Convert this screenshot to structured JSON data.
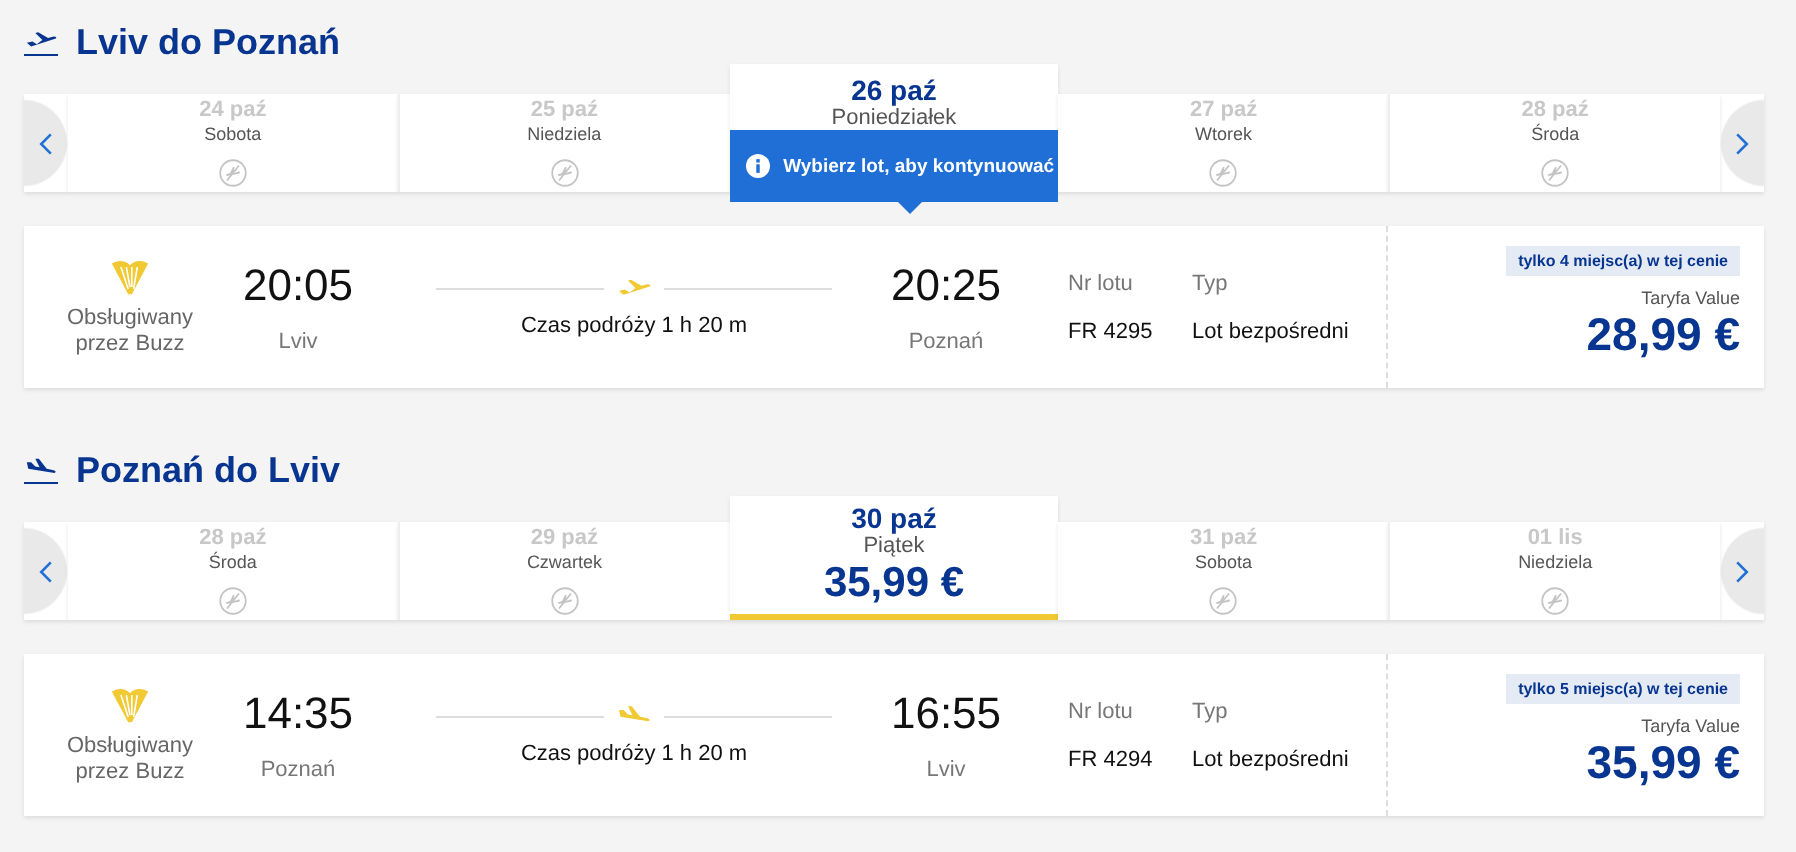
{
  "sections": [
    {
      "kind": "outbound",
      "title": "Lviv do Poznań",
      "dates": [
        {
          "date": "24 paź",
          "day": "Sobota",
          "selected": false
        },
        {
          "date": "25 paź",
          "day": "Niedziela",
          "selected": false
        },
        {
          "date": "26 paź",
          "day": "Poniedziałek",
          "selected": true
        },
        {
          "date": "27 paź",
          "day": "Wtorek",
          "selected": false
        },
        {
          "date": "28 paź",
          "day": "Środa",
          "selected": false
        }
      ],
      "tooltip": "Wybierz lot, aby kontynuować",
      "flight": {
        "operator": "Obsługiwany przez Buzz",
        "dep_time": "20:05",
        "dep_city": "Lviv",
        "duration": "Czas podróży 1 h 20 m",
        "arr_time": "20:25",
        "arr_city": "Poznań",
        "flight_no_label": "Nr lotu",
        "flight_no": "FR 4295",
        "type_label": "Typ",
        "type": "Lot bezpośredni",
        "seats": "tylko 4 miejsc(a) w tej cenie",
        "fare": "Taryfa Value",
        "price": "28,99 €"
      }
    },
    {
      "kind": "return",
      "title": "Poznań do Lviv",
      "dates": [
        {
          "date": "28 paź",
          "day": "Środa",
          "selected": false
        },
        {
          "date": "29 paź",
          "day": "Czwartek",
          "selected": false
        },
        {
          "date": "30 paź",
          "day": "Piątek",
          "selected": true,
          "price": "35,99 €"
        },
        {
          "date": "31 paź",
          "day": "Sobota",
          "selected": false
        },
        {
          "date": "01 lis",
          "day": "Niedziela",
          "selected": false
        }
      ],
      "flight": {
        "operator": "Obsługiwany przez Buzz",
        "dep_time": "14:35",
        "dep_city": "Poznań",
        "duration": "Czas podróży 1 h 20 m",
        "arr_time": "16:55",
        "arr_city": "Lviv",
        "flight_no_label": "Nr lotu",
        "flight_no": "FR 4294",
        "type_label": "Typ",
        "type": "Lot bezpośredni",
        "seats": "tylko 5 miejsc(a) w tej cenie",
        "fare": "Taryfa Value",
        "price": "35,99 €"
      }
    }
  ]
}
